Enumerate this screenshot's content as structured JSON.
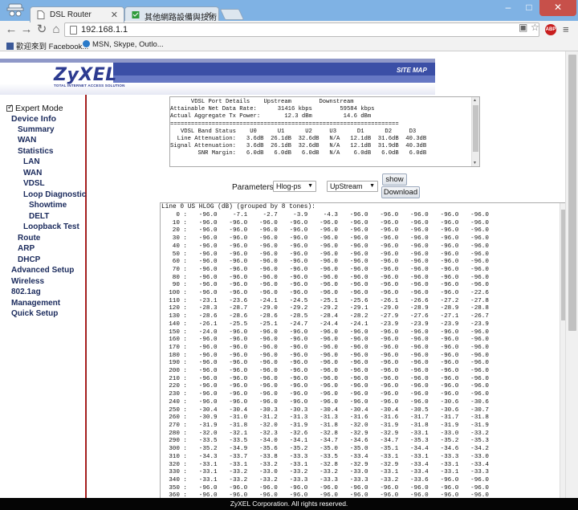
{
  "browser": {
    "tabs": [
      {
        "title": "DSL Router",
        "active": true
      },
      {
        "title": "其他網路設備與技術 - VD",
        "active": false
      }
    ],
    "address": "192.168.1.1",
    "bookmarks": [
      {
        "label": "歡迎來到 Facebook..."
      },
      {
        "label": "MSN, Skype, Outlo..."
      }
    ],
    "window_buttons": {
      "minimize": "–",
      "maximize": "□",
      "close": "✕"
    }
  },
  "router": {
    "logo": "ZyXEL",
    "logo_tagline": "TOTAL INTERNET ACCESS SOLUTION",
    "site_map": "SITE MAP",
    "expert_mode": "Expert Mode",
    "nav": {
      "device_info": "Device Info",
      "summary": "Summary",
      "wan": "WAN",
      "statistics": "Statistics",
      "stat_lan": "LAN",
      "stat_wan": "WAN",
      "stat_vdsl": "VDSL",
      "loop_diag": "Loop Diagnostic",
      "showtime": "Showtime",
      "delt": "DELT",
      "loopback": "Loopback Test",
      "route": "Route",
      "arp": "ARP",
      "dhcp": "DHCP",
      "advanced": "Advanced Setup",
      "wireless": "Wireless",
      "w80211": "802.1ag",
      "management": "Management",
      "quick_setup": "Quick Setup"
    },
    "port_details": "      VDSL Port Details    Upstream        Downstream\nAttainable Net Data Rate:      31416 kbps        59584 kbps\nActual Aggregate Tx Power:       12.3 dBm         14.6 dBm\n==================================================================\n   VDSL Band Status    U0      U1      U2     U3      D1      D2     D3\n  Line Attenuation:   3.6dB  26.1dB  32.6dB   N/A   12.1dB  31.6dB  40.3dB\nSignal Attenuation:   3.6dB  26.1dB  32.6dB   N/A   12.1dB  31.9dB  40.3dB\n        SNR Margin:   6.0dB   6.0dB   6.0dB   N/A    6.0dB   6.0dB   6.0dB",
    "parameters_label": "Parameters:",
    "param_select": "Hlog-ps",
    "direction_select": "UpStream",
    "show_button": "show",
    "download_button": "Download",
    "hlog_title": "Line 0 US HLOG (dB) (grouped by 8 tones):",
    "hlog_rows": [
      [
        "0 :",
        "-96.0",
        "-7.1",
        "-2.7",
        "-3.9",
        "-4.3",
        "-96.0",
        "-96.0",
        "-96.0",
        "-96.0",
        "-96.0"
      ],
      [
        "10 :",
        "-96.0",
        "-96.0",
        "-96.0",
        "-96.0",
        "-96.0",
        "-96.0",
        "-96.0",
        "-96.0",
        "-96.0",
        "-96.0"
      ],
      [
        "20 :",
        "-96.0",
        "-96.0",
        "-96.0",
        "-96.0",
        "-96.0",
        "-96.0",
        "-96.0",
        "-96.0",
        "-96.0",
        "-96.0"
      ],
      [
        "30 :",
        "-96.0",
        "-96.0",
        "-96.0",
        "-96.0",
        "-96.0",
        "-96.0",
        "-96.0",
        "-96.0",
        "-96.0",
        "-96.0"
      ],
      [
        "40 :",
        "-96.0",
        "-96.0",
        "-96.0",
        "-96.0",
        "-96.0",
        "-96.0",
        "-96.0",
        "-96.0",
        "-96.0",
        "-96.0"
      ],
      [
        "50 :",
        "-96.0",
        "-96.0",
        "-96.0",
        "-96.0",
        "-96.0",
        "-96.0",
        "-96.0",
        "-96.0",
        "-96.0",
        "-96.0"
      ],
      [
        "60 :",
        "-96.0",
        "-96.0",
        "-96.0",
        "-96.0",
        "-96.0",
        "-96.0",
        "-96.0",
        "-96.0",
        "-96.0",
        "-96.0"
      ],
      [
        "70 :",
        "-96.0",
        "-96.0",
        "-96.0",
        "-96.0",
        "-96.0",
        "-96.0",
        "-96.0",
        "-96.0",
        "-96.0",
        "-96.0"
      ],
      [
        "80 :",
        "-96.0",
        "-96.0",
        "-96.0",
        "-96.0",
        "-96.0",
        "-96.0",
        "-96.0",
        "-96.0",
        "-96.0",
        "-96.0"
      ],
      [
        "90 :",
        "-96.0",
        "-96.0",
        "-96.0",
        "-96.0",
        "-96.0",
        "-96.0",
        "-96.0",
        "-96.0",
        "-96.0",
        "-96.0"
      ],
      [
        "100 :",
        "-96.0",
        "-96.0",
        "-96.0",
        "-96.0",
        "-96.0",
        "-96.0",
        "-96.0",
        "-96.0",
        "-96.0",
        "-22.6"
      ],
      [
        "110 :",
        "-23.1",
        "-23.6",
        "-24.1",
        "-24.5",
        "-25.1",
        "-25.6",
        "-26.1",
        "-26.6",
        "-27.2",
        "-27.8"
      ],
      [
        "120 :",
        "-28.3",
        "-28.7",
        "-29.0",
        "-29.2",
        "-29.2",
        "-29.1",
        "-29.0",
        "-28.9",
        "-28.9",
        "-28.8"
      ],
      [
        "130 :",
        "-28.6",
        "-28.6",
        "-28.6",
        "-28.5",
        "-28.4",
        "-28.2",
        "-27.9",
        "-27.6",
        "-27.1",
        "-26.7"
      ],
      [
        "140 :",
        "-26.1",
        "-25.5",
        "-25.1",
        "-24.7",
        "-24.4",
        "-24.1",
        "-23.9",
        "-23.9",
        "-23.9",
        "-23.9"
      ],
      [
        "150 :",
        "-24.0",
        "-96.0",
        "-96.0",
        "-96.0",
        "-96.0",
        "-96.0",
        "-96.0",
        "-96.0",
        "-96.0",
        "-96.0"
      ],
      [
        "160 :",
        "-96.0",
        "-96.0",
        "-96.0",
        "-96.0",
        "-96.0",
        "-96.0",
        "-96.0",
        "-96.0",
        "-96.0",
        "-96.0"
      ],
      [
        "170 :",
        "-96.0",
        "-96.0",
        "-96.0",
        "-96.0",
        "-96.0",
        "-96.0",
        "-96.0",
        "-96.0",
        "-96.0",
        "-96.0"
      ],
      [
        "180 :",
        "-96.0",
        "-96.0",
        "-96.0",
        "-96.0",
        "-96.0",
        "-96.0",
        "-96.0",
        "-96.0",
        "-96.0",
        "-96.0"
      ],
      [
        "190 :",
        "-96.0",
        "-96.0",
        "-96.0",
        "-96.0",
        "-96.0",
        "-96.0",
        "-96.0",
        "-96.0",
        "-96.0",
        "-96.0"
      ],
      [
        "200 :",
        "-96.0",
        "-96.0",
        "-96.0",
        "-96.0",
        "-96.0",
        "-96.0",
        "-96.0",
        "-96.0",
        "-96.0",
        "-96.0"
      ],
      [
        "210 :",
        "-96.0",
        "-96.0",
        "-96.0",
        "-96.0",
        "-96.0",
        "-96.0",
        "-96.0",
        "-96.0",
        "-96.0",
        "-96.0"
      ],
      [
        "220 :",
        "-96.0",
        "-96.0",
        "-96.0",
        "-96.0",
        "-96.0",
        "-96.0",
        "-96.0",
        "-96.0",
        "-96.0",
        "-96.0"
      ],
      [
        "230 :",
        "-96.0",
        "-96.0",
        "-96.0",
        "-96.0",
        "-96.0",
        "-96.0",
        "-96.0",
        "-96.0",
        "-96.0",
        "-96.0"
      ],
      [
        "240 :",
        "-96.0",
        "-96.0",
        "-96.0",
        "-96.0",
        "-96.0",
        "-96.0",
        "-96.0",
        "-96.0",
        "-30.6",
        "-30.6"
      ],
      [
        "250 :",
        "-30.4",
        "-30.4",
        "-30.3",
        "-30.3",
        "-30.4",
        "-30.4",
        "-30.4",
        "-30.5",
        "-30.6",
        "-30.7"
      ],
      [
        "260 :",
        "-30.9",
        "-31.0",
        "-31.2",
        "-31.3",
        "-31.3",
        "-31.6",
        "-31.6",
        "-31.7",
        "-31.7",
        "-31.8"
      ],
      [
        "270 :",
        "-31.9",
        "-31.8",
        "-32.0",
        "-31.9",
        "-31.8",
        "-32.0",
        "-31.9",
        "-31.8",
        "-31.9",
        "-31.9"
      ],
      [
        "280 :",
        "-32.0",
        "-32.1",
        "-32.3",
        "-32.6",
        "-32.8",
        "-32.9",
        "-32.9",
        "-33.1",
        "-33.0",
        "-33.2"
      ],
      [
        "290 :",
        "-33.5",
        "-33.5",
        "-34.0",
        "-34.1",
        "-34.7",
        "-34.6",
        "-34.7",
        "-35.3",
        "-35.2",
        "-35.3"
      ],
      [
        "300 :",
        "-35.2",
        "-34.9",
        "-35.6",
        "-35.2",
        "-35.0",
        "-35.0",
        "-35.1",
        "-34.4",
        "-34.6",
        "-34.2"
      ],
      [
        "310 :",
        "-34.3",
        "-33.7",
        "-33.8",
        "-33.3",
        "-33.5",
        "-33.4",
        "-33.1",
        "-33.1",
        "-33.3",
        "-33.0"
      ],
      [
        "320 :",
        "-33.1",
        "-33.1",
        "-33.2",
        "-33.1",
        "-32.8",
        "-32.9",
        "-32.9",
        "-33.4",
        "-33.1",
        "-33.4"
      ],
      [
        "330 :",
        "-33.1",
        "-33.2",
        "-33.0",
        "-33.2",
        "-33.2",
        "-33.0",
        "-33.1",
        "-33.4",
        "-33.1",
        "-33.3"
      ],
      [
        "340 :",
        "-33.1",
        "-33.2",
        "-33.2",
        "-33.3",
        "-33.3",
        "-33.3",
        "-33.2",
        "-33.6",
        "-96.0",
        "-96.0"
      ],
      [
        "350 :",
        "-96.0",
        "-96.0",
        "-96.0",
        "-96.0",
        "-96.0",
        "-96.0",
        "-96.0",
        "-96.0",
        "-96.0",
        "-96.0"
      ],
      [
        "360 :",
        "-96.0",
        "-96.0",
        "-96.0",
        "-96.0",
        "-96.0",
        "-96.0",
        "-96.0",
        "-96.0",
        "-96.0",
        "-96.0"
      ]
    ],
    "footer": "ZyXEL Corporation. All rights reserved."
  }
}
